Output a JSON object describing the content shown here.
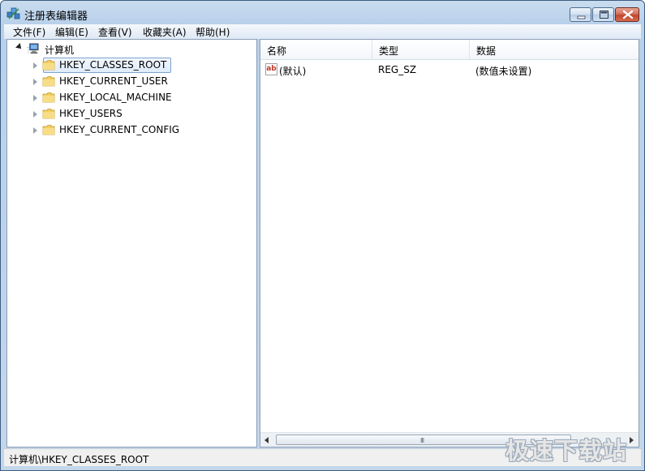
{
  "window": {
    "title": "注册表编辑器",
    "icon": "registry-editor-icon"
  },
  "menu": {
    "items": [
      {
        "label": "文件(F)"
      },
      {
        "label": "编辑(E)"
      },
      {
        "label": "查看(V)"
      },
      {
        "label": "收藏夹(A)"
      },
      {
        "label": "帮助(H)"
      }
    ]
  },
  "tree": {
    "root": {
      "label": "计算机",
      "icon": "computer-icon",
      "expanded": true
    },
    "children": [
      {
        "label": "HKEY_CLASSES_ROOT",
        "selected": true
      },
      {
        "label": "HKEY_CURRENT_USER"
      },
      {
        "label": "HKEY_LOCAL_MACHINE"
      },
      {
        "label": "HKEY_USERS"
      },
      {
        "label": "HKEY_CURRENT_CONFIG"
      }
    ]
  },
  "list": {
    "columns": [
      "名称",
      "类型",
      "数据"
    ],
    "rows": [
      {
        "name": "(默认)",
        "type": "REG_SZ",
        "data": "(数值未设置)",
        "icon": "string-value-icon"
      }
    ],
    "value_icon_text": "ab"
  },
  "scrollbar": {
    "grip": "III"
  },
  "status": {
    "path": "计算机\\HKEY_CLASSES_ROOT"
  },
  "watermark": {
    "text": "极速下载站"
  },
  "colors": {
    "titlebar": "#c9dcef",
    "selection_border": "#7da2ce",
    "close_button": "#c1442c"
  }
}
